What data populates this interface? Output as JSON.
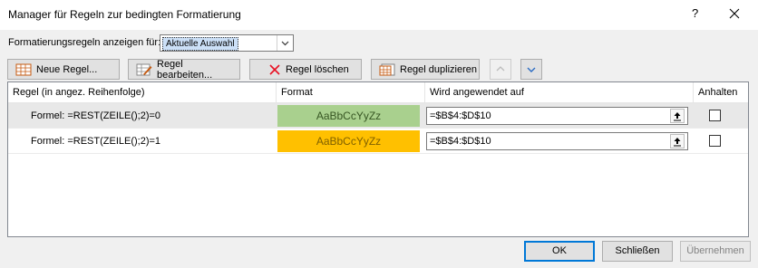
{
  "window": {
    "title": "Manager für Regeln zur bedingten Formatierung",
    "help": "?"
  },
  "show_rules": {
    "label": "Formatierungsregeln anzeigen für:",
    "value": "Aktuelle Auswahl"
  },
  "toolbar": {
    "new_rule": "Neue Regel...",
    "edit_rule": "Regel bearbeiten...",
    "delete_rule": "Regel löschen",
    "duplicate_rule": "Regel duplizieren"
  },
  "columns": [
    "Regel (in angez. Reihenfolge)",
    "Format",
    "Wird angewendet auf",
    "Anhalten"
  ],
  "rules": [
    {
      "rule": "Formel: =REST(ZEILE();2)=0",
      "format_preview": "AaBbCcYyZz",
      "format_color": "#a9d08e",
      "applies_to": "=$B$4:$D$10",
      "stop": false,
      "selected": true
    },
    {
      "rule": "Formel: =REST(ZEILE();2)=1",
      "format_preview": "AaBbCcYyZz",
      "format_color": "#ffc000",
      "applies_to": "=$B$4:$D$10",
      "stop": false,
      "selected": false
    }
  ],
  "buttons": {
    "ok": "OK",
    "close": "Schließen",
    "apply": "Übernehmen"
  }
}
